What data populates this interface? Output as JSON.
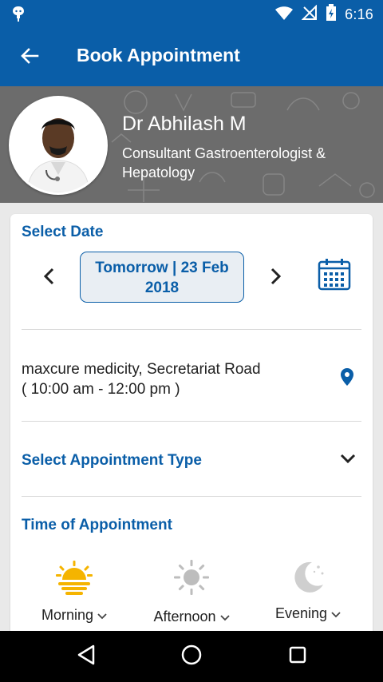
{
  "status_bar": {
    "time": "6:16",
    "icons": [
      "android-debug-icon",
      "wifi-icon",
      "no-signal-icon",
      "battery-charging-icon"
    ]
  },
  "app_bar": {
    "title": "Book Appointment",
    "back_icon": "arrow-left-icon"
  },
  "doctor": {
    "name": "Dr Abhilash M",
    "specialization": "Consultant Gastroenterologist & Hepatology"
  },
  "select_date": {
    "title": "Select Date",
    "date_line1": "Tomorrow | 23 Feb",
    "date_line2": "2018",
    "prev_icon": "chevron-left-icon",
    "next_icon": "chevron-right-icon",
    "calendar_icon": "calendar-icon"
  },
  "location": {
    "line1": "maxcure medicity, Secretariat Road",
    "line2": "( 10:00 am - 12:00 pm )",
    "icon": "map-pin-icon"
  },
  "appointment_type": {
    "label": "Select Appointment Type",
    "icon": "chevron-down-icon"
  },
  "time_of_appointment": {
    "title": "Time of Appointment",
    "slots": [
      {
        "label": "Morning",
        "icon": "sunrise-icon",
        "color": "#f5b400"
      },
      {
        "label": "Afternoon",
        "icon": "sun-icon",
        "color": "#bdbdbd"
      },
      {
        "label": "Evening",
        "icon": "moon-icon",
        "color": "#c8c8c8"
      }
    ]
  },
  "colors": {
    "primary": "#0a5ea8",
    "accent": "#f5b400"
  },
  "nav_bar": {
    "icons": [
      "back-triangle-icon",
      "home-circle-icon",
      "recents-square-icon"
    ]
  }
}
